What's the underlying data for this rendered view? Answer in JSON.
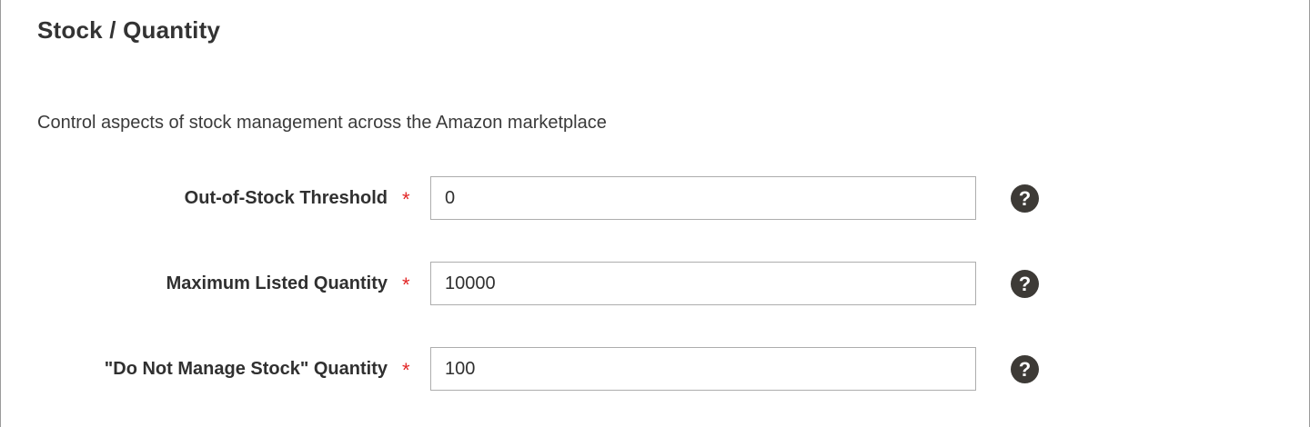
{
  "section": {
    "title": "Stock / Quantity",
    "description": "Control aspects of stock management across the Amazon marketplace"
  },
  "fields": [
    {
      "label": "Out-of-Stock Threshold",
      "required_mark": "*",
      "value": "0",
      "help_icon": "question-circle-icon"
    },
    {
      "label": "Maximum Listed Quantity",
      "required_mark": "*",
      "value": "10000",
      "help_icon": "question-circle-icon"
    },
    {
      "label": "\"Do Not Manage Stock\" Quantity",
      "required_mark": "*",
      "value": "100",
      "help_icon": "question-circle-icon"
    }
  ],
  "colors": {
    "required": "#e22626",
    "help_icon": "#3d3a36",
    "input_border": "#adadad",
    "text": "#303030"
  }
}
